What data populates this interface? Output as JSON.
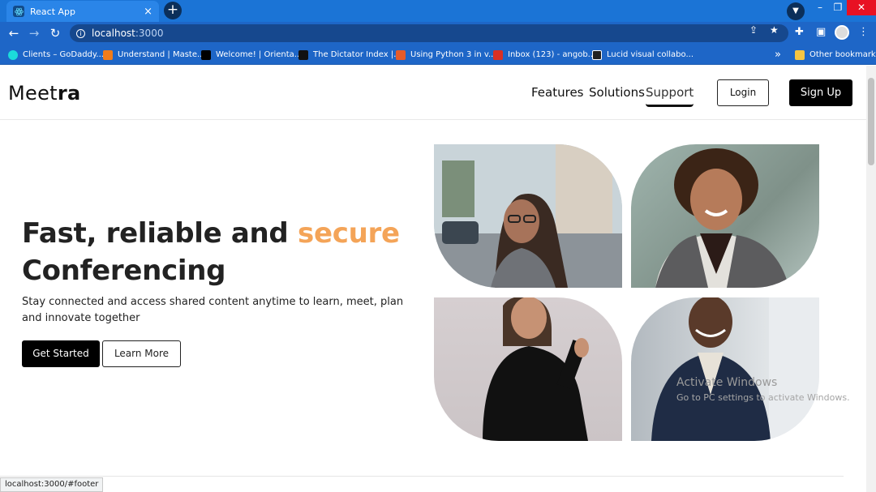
{
  "browser": {
    "tab_title": "React App",
    "tab_close": "×",
    "new_tab": "+",
    "url_host": "localhost",
    "url_port": ":3000",
    "window_min": "–",
    "window_max": "❐",
    "window_close": "✕",
    "bookmarks": [
      {
        "label": "Clients – GoDaddy...",
        "icon_color": "#1bdbdb"
      },
      {
        "label": "Understand | Maste...",
        "icon_color": "#f07c1b"
      },
      {
        "label": "Welcome! | Orienta...",
        "icon_color": "#000000"
      },
      {
        "label": "The Dictator Index |...",
        "icon_color": "#111111"
      },
      {
        "label": "Using Python 3 in v...",
        "icon_color": "#e55b2a"
      },
      {
        "label": "Inbox (123) - angob...",
        "icon_color": "#d93025"
      },
      {
        "label": "Lucid visual collabo...",
        "icon_color": "#222222"
      }
    ],
    "bookmarks_more": "»",
    "other_bookmarks": "Other bookmarks",
    "status_url": "localhost:3000/#footer"
  },
  "nav": {
    "logo_light": "Meet",
    "logo_bold": "ra",
    "links": [
      "Features",
      "Solutions",
      "Support"
    ],
    "login": "Login",
    "signup": "Sign Up"
  },
  "hero": {
    "title_part1": "Fast, reliable and ",
    "title_accent": "secure",
    "title_part2": "Conferencing",
    "subtitle": "Stay connected and access shared content anytime to learn, meet, plan and innovate together",
    "get_started": "Get Started",
    "learn_more": "Learn More"
  },
  "watermark": {
    "title": "Activate Windows",
    "subtitle": "Go to PC settings to activate Windows."
  },
  "colors": {
    "accent": "#f4a458",
    "chrome_blue": "#1b74d6"
  }
}
